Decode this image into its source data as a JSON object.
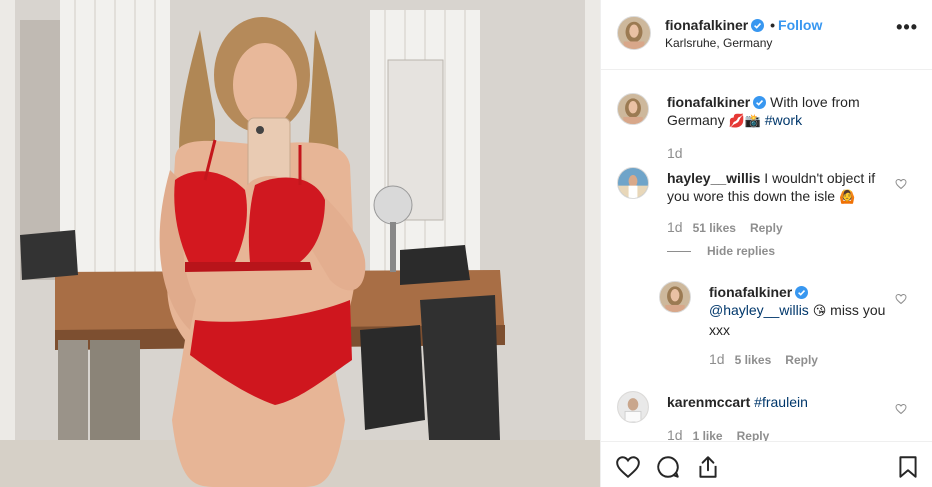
{
  "post": {
    "author": "fionafalkiner",
    "dot": "•",
    "follow_label": "Follow",
    "location": "Karlsruhe, Germany",
    "more_label": "•••"
  },
  "caption": {
    "author": "fionafalkiner",
    "text_before": "With love from Germany",
    "emojis": "💋📸",
    "hashtag": "#work",
    "time": "1d"
  },
  "comments": [
    {
      "author": "hayley__willis",
      "text": "I wouldn't object if you wore this down the isle",
      "emoji": "🙆",
      "time": "1d",
      "likes": "51 likes",
      "reply": "Reply"
    },
    {
      "author": "karenmccart",
      "hashtag": "#fraulein",
      "time": "1d",
      "likes": "1 like",
      "reply": "Reply"
    }
  ],
  "hide_replies_label": "Hide replies",
  "reply": {
    "author": "fionafalkiner",
    "mention": "@hayley__willis",
    "emoji": "😘",
    "text": "miss you xxx",
    "time": "1d",
    "likes": "5 likes",
    "reply_label": "Reply"
  },
  "icons": {
    "like": "heart-icon",
    "comment": "comment-icon",
    "share": "share-icon",
    "save": "bookmark-icon",
    "verified": "verified-badge-icon",
    "more": "more-options-icon"
  },
  "colors": {
    "accent": "#3897f0",
    "verified": "#3897f0",
    "text": "#262626",
    "muted": "#8e8e8e",
    "link": "#00376b"
  }
}
